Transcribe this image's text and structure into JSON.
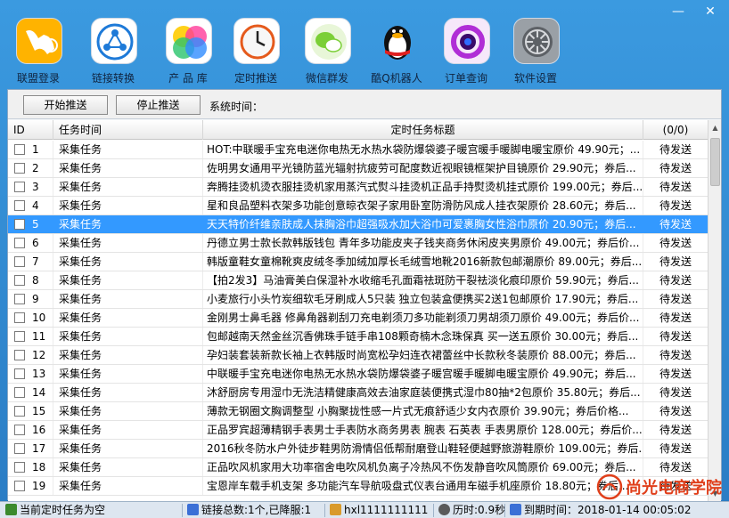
{
  "window": {
    "minimize": "—",
    "close": "✕"
  },
  "toolbar": [
    {
      "label": "联盟登录",
      "icon": "kangaroo-icon"
    },
    {
      "label": "链接转换",
      "icon": "share-link-icon"
    },
    {
      "label": "产 品 库",
      "icon": "color-bubbles-icon"
    },
    {
      "label": "定时推送",
      "icon": "clock-icon"
    },
    {
      "label": "微信群发",
      "icon": "wechat-icon"
    },
    {
      "label": "酷Q机器人",
      "icon": "penguin-icon"
    },
    {
      "label": "订单查询",
      "icon": "order-ring-icon"
    },
    {
      "label": "软件设置",
      "icon": "settings-icon"
    }
  ],
  "actions": {
    "start": "开始推送",
    "stop": "停止推送",
    "sys_time_label": "系统时间："
  },
  "columns": {
    "id": "ID",
    "task_time": "任务时间",
    "title": "定时任务标题",
    "count": "(0/0)"
  },
  "rows": [
    {
      "id": "1",
      "time": "采集任务",
      "title": "HOT:中联暖手宝充电迷你电热无水热水袋防爆袋婆子暖宫暖手暖脚电暖宝原价 49.90元；...",
      "status": "待发送"
    },
    {
      "id": "2",
      "time": "采集任务",
      "title": "佐明男女通用平光镜防蓝光辐射抗疲劳可配度数近视眼镜框架护目镜原价 29.90元；券后...",
      "status": "待发送"
    },
    {
      "id": "3",
      "time": "采集任务",
      "title": "奔腾挂烫机烫衣服挂烫机家用蒸汽式熨斗挂烫机正品手持熨烫机挂式原价 199.00元；券后...",
      "status": "待发送"
    },
    {
      "id": "4",
      "time": "采集任务",
      "title": "星和良品塑料衣架多功能创意晾衣架子家用卧室防滑防风成人挂衣架原价 28.60元；券后...",
      "status": "待发送"
    },
    {
      "id": "5",
      "time": "采集任务",
      "title": "天天特价纤维亲肤成人抹胸浴巾超强吸水加大浴巾可爱裹胸女性浴巾原价 20.90元；券后...",
      "status": "待发送"
    },
    {
      "id": "6",
      "time": "采集任务",
      "title": "丹德立男士款长款韩版钱包 青年多功能皮夹子钱夹商务休闲皮夹男原价 49.00元；券后价...",
      "status": "待发送"
    },
    {
      "id": "7",
      "time": "采集任务",
      "title": "韩版童鞋女童棉靴爽皮绒冬季加绒加厚长毛绒雪地靴2016新款包邮潮原价 89.00元；券后...",
      "status": "待发送"
    },
    {
      "id": "8",
      "time": "采集任务",
      "title": "【拍2发3】马油膏美白保湿补水收缩毛孔面霜祛斑防干裂祛淡化痕印原价 59.90元；券后...",
      "status": "待发送"
    },
    {
      "id": "9",
      "time": "采集任务",
      "title": "小麦旅行小头竹炭细软毛牙刷成人5只装 独立包装盒便携买2送1包邮原价 17.90元；券后...",
      "status": "待发送"
    },
    {
      "id": "10",
      "time": "采集任务",
      "title": "金刚男士鼻毛器 修鼻角器剃刮刀充电剃须刀多功能剃须刀男胡须刀原价 49.00元；券后价...",
      "status": "待发送"
    },
    {
      "id": "11",
      "time": "采集任务",
      "title": "包邮越南天然金丝沉香佛珠手链手串108颗奇楠木念珠保真 买一送五原价 30.00元；券后...",
      "status": "待发送"
    },
    {
      "id": "12",
      "time": "采集任务",
      "title": "孕妇装套装新款长袖上衣韩版时尚宽松孕妇连衣裙蕾丝中长款秋冬装原价 88.00元；券后...",
      "status": "待发送"
    },
    {
      "id": "13",
      "time": "采集任务",
      "title": "中联暖手宝充电迷你电热无水热水袋防爆袋婆子暖宫暖手暖脚电暖宝原价 49.90元；券后...",
      "status": "待发送"
    },
    {
      "id": "14",
      "time": "采集任务",
      "title": "沐舒厨房专用湿巾无洗洁精健康高效去油家庭装便携式湿巾80抽*2包原价 35.80元；券后...",
      "status": "待发送"
    },
    {
      "id": "15",
      "time": "采集任务",
      "title": "薄款无钢圈文胸调整型  小胸聚拢性感一片式无痕舒适少女内衣原价 39.90元；券后价格...",
      "status": "待发送"
    },
    {
      "id": "16",
      "time": "采集任务",
      "title": "正品罗宾超薄精钢手表男士手表防水商务男表 腕表 石英表 手表男原价 128.00元；券后价...",
      "status": "待发送"
    },
    {
      "id": "17",
      "time": "采集任务",
      "title": "2016秋冬防水户外徒步鞋男防滑情侣低帮耐磨登山鞋轻便越野旅游鞋原价 109.00元；券后...",
      "status": "待发送"
    },
    {
      "id": "18",
      "time": "采集任务",
      "title": "正品吹风机家用大功率宿舍电吹风机负离子冷热风不伤发静音吹风筒原价 69.00元；券后...",
      "status": "待发送"
    },
    {
      "id": "19",
      "time": "采集任务",
      "title": "宝恩岸车载手机支架 多功能汽车导航吸盘式仪表台通用车磁手机座原价 18.80元；券后...",
      "status": "待发送"
    }
  ],
  "selected_row": "5",
  "status": {
    "timer": "当前定时任务为空",
    "links": "链接总数:1个,已降服:1",
    "user": "hxl1111111111",
    "duration": "历时:0.9秒",
    "expiry": "到期时间：2018-01-14 00:05:02"
  },
  "watermark": "尚光电商学院",
  "colors": {
    "selection": "#3399ff",
    "window_blue": "#2a7cc4"
  }
}
